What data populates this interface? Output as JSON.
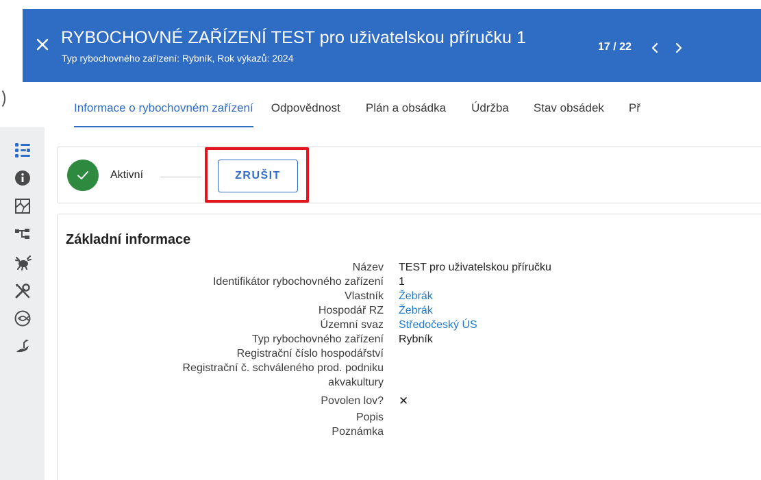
{
  "header": {
    "title": "RYBOCHOVNÉ ZAŘÍZENÍ TEST pro uživatelskou příručku 1",
    "subtitle": "Typ rybochovného zařízení: Rybník, Rok výkazů: 2024",
    "pager": "17 / 22",
    "close_icon": "close-icon",
    "prev_icon": "chevron-left-icon",
    "next_icon": "chevron-right-icon",
    "color": "#2f6dc4"
  },
  "tabs": [
    {
      "label": "Informace o rybochovném zařízení",
      "active": true
    },
    {
      "label": "Odpovědnost"
    },
    {
      "label": "Plán a obsádka"
    },
    {
      "label": "Údržba"
    },
    {
      "label": "Stav obsádek"
    },
    {
      "label": "Př"
    }
  ],
  "sidebar": {
    "icons": [
      "structure-icon",
      "info-icon",
      "map-icon",
      "hierarchy-icon",
      "crab-icon",
      "tools-icon",
      "fish-net-icon",
      "heron-icon"
    ]
  },
  "status": {
    "label": "Aktivní",
    "cancel_label": "ZRUŠIT",
    "check_color": "#2e8a3e"
  },
  "basic_info": {
    "title": "Základní informace",
    "fields": [
      {
        "label": "Název",
        "value": "TEST pro uživatelskou příručku"
      },
      {
        "label": "Identifikátor rybochovného zařízení",
        "value": "1"
      },
      {
        "label": "Vlastník",
        "value": "Žebrák",
        "link": true
      },
      {
        "label": "Hospodář RZ",
        "value": "Žebrák",
        "link": true
      },
      {
        "label": "Územní svaz",
        "value": "Středočeský ÚS",
        "link": true
      },
      {
        "label": "Typ rybochovného zařízení",
        "value": "Rybník"
      },
      {
        "label": "Registrační číslo hospodářství",
        "value": ""
      },
      {
        "label": "Registrační č. schváleného prod. podniku",
        "value": ""
      },
      {
        "label": "akvakultury",
        "value": ""
      },
      {
        "label": "Povolen lov?",
        "value": "✕"
      },
      {
        "label": "Popis",
        "value": ""
      },
      {
        "label": "Poznámka",
        "value": ""
      }
    ]
  }
}
